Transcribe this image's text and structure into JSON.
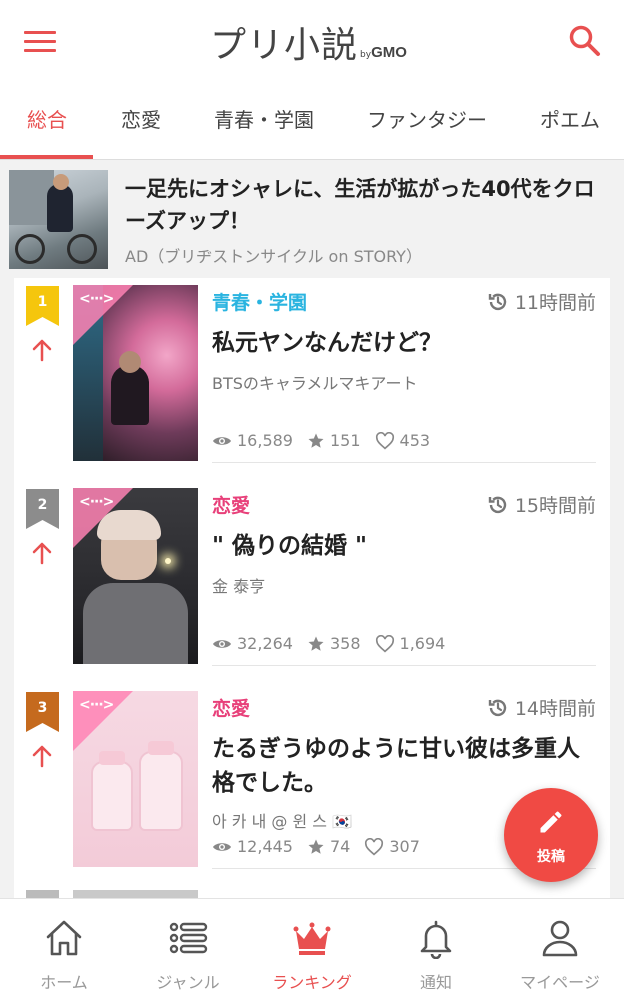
{
  "header": {
    "logo_text": "プリ小説",
    "logo_by": "by",
    "logo_gmo": "GMO",
    "menu_icon": "hamburger-menu-icon",
    "search_icon": "search-icon",
    "accent_color": "#e85050"
  },
  "tabs": [
    {
      "label": "総合",
      "active": true
    },
    {
      "label": "恋愛",
      "active": false
    },
    {
      "label": "青春・学園",
      "active": false
    },
    {
      "label": "ファンタジー",
      "active": false
    },
    {
      "label": "ポエム",
      "active": false
    }
  ],
  "ad": {
    "title": "一足先にオシャレに、生活が拡がった40代をクローズアップ！",
    "source": "AD（ブリヂストンサイクル on STORY）"
  },
  "ranking": [
    {
      "rank": "1",
      "badge_color": "#f5c60d",
      "genre": "青春・学園",
      "genre_color": "#2ab4e0",
      "time": "11時間前",
      "title": "私元ヤンなんだけど？",
      "author": "BTSのキャラメルマキアート",
      "views": "16,589",
      "stars": "151",
      "likes": "453"
    },
    {
      "rank": "2",
      "badge_color": "#8c8c8c",
      "genre": "恋愛",
      "genre_color": "#e8407a",
      "time": "15時間前",
      "title": "\" 偽りの結婚 \"",
      "author": "金 泰亨",
      "views": "32,264",
      "stars": "358",
      "likes": "1,694"
    },
    {
      "rank": "3",
      "badge_color": "#c56a1e",
      "genre": "恋愛",
      "genre_color": "#e8407a",
      "time": "14時間前",
      "title": "たるぎうゆのように甘い彼は多重人格でした。",
      "author": "아 카 내 @ 윈 스 🇰🇷",
      "views": "12,445",
      "stars": "74",
      "likes": "307"
    }
  ],
  "fab": {
    "label": "投稿",
    "icon": "pencil-icon"
  },
  "bottom_nav": [
    {
      "label": "ホーム",
      "icon": "home-icon",
      "active": false
    },
    {
      "label": "ジャンル",
      "icon": "list-icon",
      "active": false
    },
    {
      "label": "ランキング",
      "icon": "crown-icon",
      "active": true
    },
    {
      "label": "通知",
      "icon": "bell-icon",
      "active": false
    },
    {
      "label": "マイページ",
      "icon": "user-icon",
      "active": false
    }
  ]
}
